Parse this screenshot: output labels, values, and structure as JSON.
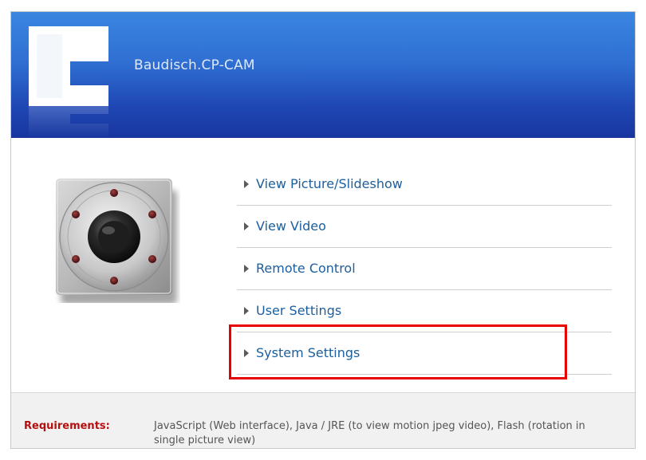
{
  "header": {
    "brand_name": "Baudisch.CP-CAM",
    "logo_icon": "baudisch-logo-icon"
  },
  "camera_image": {
    "icon": "webcam-icon"
  },
  "menu": {
    "items": [
      {
        "label": "View Picture/Slideshow",
        "icon": "triangle-right-icon"
      },
      {
        "label": "View Video",
        "icon": "triangle-right-icon"
      },
      {
        "label": "Remote Control",
        "icon": "triangle-right-icon"
      },
      {
        "label": "User Settings",
        "icon": "triangle-right-icon"
      },
      {
        "label": "System Settings",
        "icon": "triangle-right-icon",
        "highlighted": true
      }
    ]
  },
  "footer": {
    "requirements_label": "Requirements:",
    "requirements_text": "JavaScript (Web interface), Java / JRE (to view motion jpeg video), Flash (rotation in single picture view)"
  },
  "colors": {
    "header_top": "#3b86e0",
    "header_bottom": "#18359e",
    "link": "#1b5f9e",
    "highlight": "#e60000",
    "requirements_label": "#b50f0f"
  }
}
